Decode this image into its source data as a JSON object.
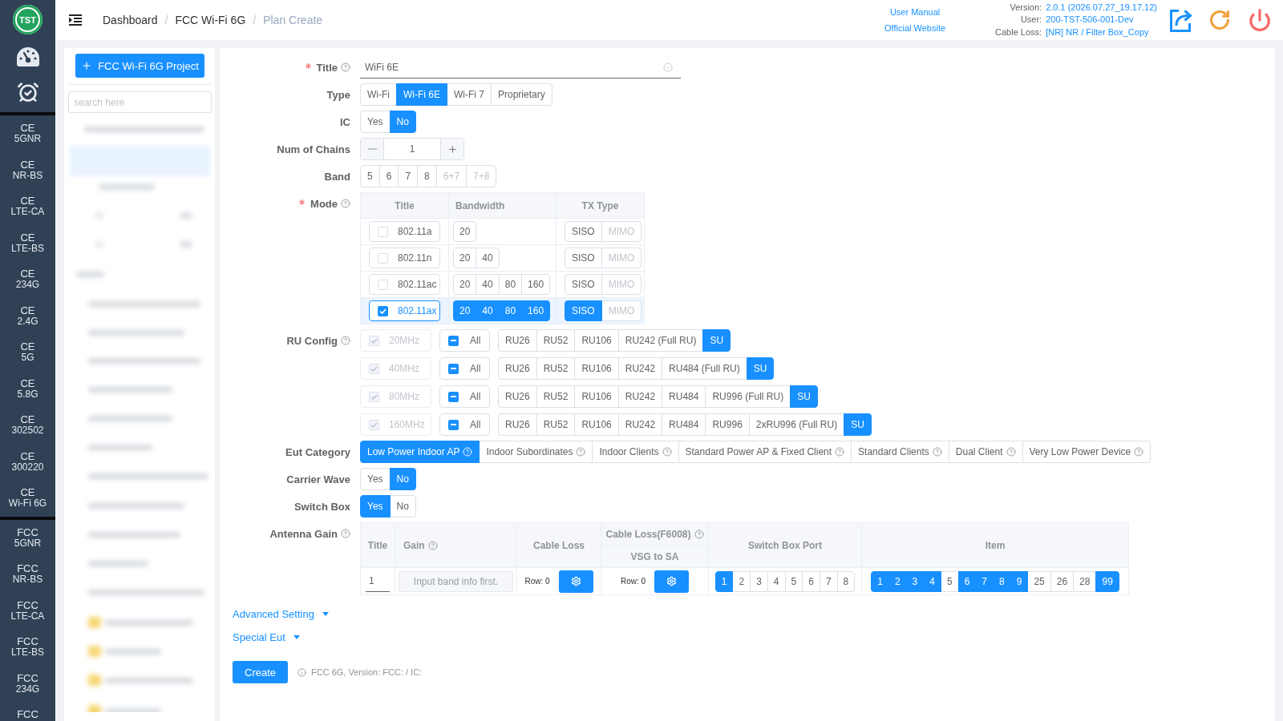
{
  "logo": {
    "text": "TST"
  },
  "nav_rail": {
    "groups": [
      {
        "items": [
          {
            "title": "CE",
            "subtitle": "5GNR",
            "selected": false
          },
          {
            "title": "CE",
            "subtitle": "NR-BS",
            "selected": false
          },
          {
            "title": "CE",
            "subtitle": "LTE-CA",
            "selected": false
          },
          {
            "title": "CE",
            "subtitle": "LTE-BS",
            "selected": false
          },
          {
            "title": "CE",
            "subtitle": "234G",
            "selected": false
          },
          {
            "title": "CE",
            "subtitle": "2.4G",
            "selected": false
          },
          {
            "title": "CE",
            "subtitle": "5G",
            "selected": false
          },
          {
            "title": "CE",
            "subtitle": "5.8G",
            "selected": false
          },
          {
            "title": "CE",
            "subtitle": "302502",
            "selected": false
          },
          {
            "title": "CE",
            "subtitle": "300220",
            "selected": false
          },
          {
            "title": "CE",
            "subtitle": "Wi-Fi 6G",
            "selected": false
          }
        ]
      },
      {
        "items": [
          {
            "title": "FCC",
            "subtitle": "5GNR",
            "selected": false
          },
          {
            "title": "FCC",
            "subtitle": "NR-BS",
            "selected": false
          },
          {
            "title": "FCC",
            "subtitle": "LTE-CA",
            "selected": false
          },
          {
            "title": "FCC",
            "subtitle": "LTE-BS",
            "selected": false
          },
          {
            "title": "FCC",
            "subtitle": "234G",
            "selected": false
          },
          {
            "title": "FCC",
            "selected": false
          }
        ]
      }
    ]
  },
  "header": {
    "breadcrumb": {
      "separator": "/",
      "items": [
        {
          "label": "Dashboard",
          "current": false
        },
        {
          "label": "FCC Wi-Fi 6G",
          "current": false
        },
        {
          "label": "Plan Create",
          "current": true
        }
      ]
    },
    "links": [
      "User Manual",
      "Official Website"
    ],
    "info": [
      {
        "label": "Version:",
        "value": "2.0.1 (2026.07.27_19.17.12)"
      },
      {
        "label": "User:",
        "value": "200-TST-506-001-Dev"
      },
      {
        "label": "Cable Loss:",
        "value": "[NR] NR / Filter Box_Copy"
      }
    ]
  },
  "project_panel": {
    "new_button": "FCC Wi-Fi 6G Project",
    "search": {
      "placeholder": "search here"
    }
  },
  "form": {
    "fields": [
      {
        "kind": "text",
        "label": "Title",
        "required": true,
        "help": true,
        "value": "WiFi 6E",
        "valid": true
      },
      {
        "kind": "choice",
        "label": "Type",
        "required": false,
        "help": false,
        "options": [
          {
            "label": "Wi-Fi",
            "selected": false,
            "disabled": false
          },
          {
            "label": "Wi-Fi 6E",
            "selected": true,
            "disabled": false
          },
          {
            "label": "Wi-Fi 7",
            "selected": false,
            "disabled": false
          },
          {
            "label": "Proprietary",
            "selected": false,
            "disabled": false
          }
        ]
      },
      {
        "kind": "choice",
        "label": "IC",
        "required": false,
        "help": false,
        "options": [
          {
            "label": "Yes",
            "selected": false,
            "disabled": false
          },
          {
            "label": "No",
            "selected": true,
            "disabled": false
          }
        ]
      },
      {
        "kind": "stepper",
        "label": "Num of Chains",
        "required": false,
        "help": false,
        "value": "1",
        "decrease_disabled": true
      },
      {
        "kind": "choice",
        "label": "Band",
        "required": false,
        "help": false,
        "options": [
          {
            "label": "5",
            "selected": false,
            "disabled": false
          },
          {
            "label": "6",
            "selected": false,
            "disabled": false
          },
          {
            "label": "7",
            "selected": false,
            "disabled": false
          },
          {
            "label": "8",
            "selected": false,
            "disabled": false
          },
          {
            "label": "6+7",
            "selected": false,
            "disabled": true
          },
          {
            "label": "7+8",
            "selected": false,
            "disabled": true
          }
        ]
      },
      {
        "kind": "mode_table",
        "label": "Mode",
        "required": true,
        "help": true,
        "columns": [
          "Title",
          "Bandwidth",
          "TX Type"
        ],
        "rows": [
          {
            "title": "802.11a",
            "checked": false,
            "bandwidths": [
              {
                "label": "20",
                "selected": false
              }
            ],
            "tx_types": [
              {
                "label": "SISO",
                "selected": false,
                "disabled": false
              },
              {
                "label": "MIMO",
                "selected": false,
                "disabled": true
              }
            ]
          },
          {
            "title": "802.11n",
            "checked": false,
            "bandwidths": [
              {
                "label": "20",
                "selected": false
              },
              {
                "label": "40",
                "selected": false
              }
            ],
            "tx_types": [
              {
                "label": "SISO",
                "selected": false,
                "disabled": false
              },
              {
                "label": "MIMO",
                "selected": false,
                "disabled": true
              }
            ]
          },
          {
            "title": "802.11ac",
            "checked": false,
            "bandwidths": [
              {
                "label": "20",
                "selected": false
              },
              {
                "label": "40",
                "selected": false
              },
              {
                "label": "80",
                "selected": false
              },
              {
                "label": "160",
                "selected": false
              }
            ],
            "tx_types": [
              {
                "label": "SISO",
                "selected": false,
                "disabled": false
              },
              {
                "label": "MIMO",
                "selected": false,
                "disabled": true
              }
            ]
          },
          {
            "title": "802.11ax",
            "checked": true,
            "bandwidths": [
              {
                "label": "20",
                "selected": true
              },
              {
                "label": "40",
                "selected": true
              },
              {
                "label": "80",
                "selected": true
              },
              {
                "label": "160",
                "selected": true
              }
            ],
            "tx_types": [
              {
                "label": "SISO",
                "selected": true,
                "disabled": false
              },
              {
                "label": "MIMO",
                "selected": false,
                "disabled": true
              }
            ]
          }
        ]
      },
      {
        "kind": "ru_config",
        "label": "RU Config",
        "required": false,
        "help": true,
        "rows": [
          {
            "bandwidth": {
              "label": "20MHz",
              "checked": true,
              "disabled": true
            },
            "all": {
              "label": "All",
              "indeterminate": true
            },
            "units": [
              {
                "label": "RU26",
                "selected": false
              },
              {
                "label": "RU52",
                "selected": false
              },
              {
                "label": "RU106",
                "selected": false
              },
              {
                "label": "RU242 (Full RU)",
                "selected": false
              },
              {
                "label": "SU",
                "selected": true
              }
            ]
          },
          {
            "bandwidth": {
              "label": "40MHz",
              "checked": true,
              "disabled": true
            },
            "all": {
              "label": "All",
              "indeterminate": true
            },
            "units": [
              {
                "label": "RU26",
                "selected": false
              },
              {
                "label": "RU52",
                "selected": false
              },
              {
                "label": "RU106",
                "selected": false
              },
              {
                "label": "RU242",
                "selected": false
              },
              {
                "label": "RU484 (Full RU)",
                "selected": false
              },
              {
                "label": "SU",
                "selected": true
              }
            ]
          },
          {
            "bandwidth": {
              "label": "80MHz",
              "checked": true,
              "disabled": true
            },
            "all": {
              "label": "All",
              "indeterminate": true
            },
            "units": [
              {
                "label": "RU26",
                "selected": false
              },
              {
                "label": "RU52",
                "selected": false
              },
              {
                "label": "RU106",
                "selected": false
              },
              {
                "label": "RU242",
                "selected": false
              },
              {
                "label": "RU484",
                "selected": false
              },
              {
                "label": "RU996 (Full RU)",
                "selected": false
              },
              {
                "label": "SU",
                "selected": true
              }
            ]
          },
          {
            "bandwidth": {
              "label": "160MHz",
              "checked": true,
              "disabled": true
            },
            "all": {
              "label": "All",
              "indeterminate": true
            },
            "units": [
              {
                "label": "RU26",
                "selected": false
              },
              {
                "label": "RU52",
                "selected": false
              },
              {
                "label": "RU106",
                "selected": false
              },
              {
                "label": "RU242",
                "selected": false
              },
              {
                "label": "RU484",
                "selected": false
              },
              {
                "label": "RU996",
                "selected": false
              },
              {
                "label": "2xRU996 (Full RU)",
                "selected": false
              },
              {
                "label": "SU",
                "selected": true
              }
            ]
          }
        ]
      },
      {
        "kind": "choice",
        "label": "Eut Category",
        "required": false,
        "help": false,
        "options": [
          {
            "label": "Low Power Indoor AP",
            "selected": true,
            "disabled": false,
            "help": true
          },
          {
            "label": "Indoor Subordinates",
            "selected": false,
            "disabled": false,
            "help": true
          },
          {
            "label": "Indoor Clients",
            "selected": false,
            "disabled": false,
            "help": true
          },
          {
            "label": "Standard Power AP & Fixed Client",
            "selected": false,
            "disabled": false,
            "help": true
          },
          {
            "label": "Standard Clients",
            "selected": false,
            "disabled": false,
            "help": true
          },
          {
            "label": "Dual Client",
            "selected": false,
            "disabled": false,
            "help": true
          },
          {
            "label": "Very Low Power Device",
            "selected": false,
            "disabled": false,
            "help": true
          }
        ]
      },
      {
        "kind": "choice",
        "label": "Carrier Wave",
        "required": false,
        "help": false,
        "options": [
          {
            "label": "Yes",
            "selected": false,
            "disabled": false
          },
          {
            "label": "No",
            "selected": true,
            "disabled": false
          }
        ]
      },
      {
        "kind": "choice",
        "label": "Switch Box",
        "required": false,
        "help": false,
        "options": [
          {
            "label": "Yes",
            "selected": true,
            "disabled": false
          },
          {
            "label": "No",
            "selected": false,
            "disabled": false
          }
        ]
      },
      {
        "kind": "antenna_table",
        "label": "Antenna Gain",
        "required": false,
        "help": true,
        "columns": [
          {
            "label": "Title",
            "help": false
          },
          {
            "label": "Gain",
            "help": true
          },
          {
            "label": "Cable Loss",
            "help": false
          },
          {
            "label": "Cable Loss(F6008)",
            "help": true,
            "sublabel": "VSG to SA"
          },
          {
            "label": "Switch Box Port",
            "help": false
          },
          {
            "label": "Item",
            "help": false
          }
        ],
        "row": {
          "title": "1",
          "gain": {
            "placeholder": "Input band info first.",
            "disabled": true
          },
          "cable_loss": "Row: 0",
          "cable_loss_f6008": "Row: 0",
          "ports": [
            {
              "label": "1",
              "selected": true
            },
            {
              "label": "2",
              "selected": false
            },
            {
              "label": "3",
              "selected": false
            },
            {
              "label": "4",
              "selected": false
            },
            {
              "label": "5",
              "selected": false
            },
            {
              "label": "6",
              "selected": false
            },
            {
              "label": "7",
              "selected": false
            },
            {
              "label": "8",
              "selected": false
            }
          ],
          "items": [
            {
              "label": "1",
              "selected": true
            },
            {
              "label": "2",
              "selected": true
            },
            {
              "label": "3",
              "selected": true
            },
            {
              "label": "4",
              "selected": true
            },
            {
              "label": "5",
              "selected": false
            },
            {
              "label": "6",
              "selected": true
            },
            {
              "label": "7",
              "selected": true
            },
            {
              "label": "8",
              "selected": true
            },
            {
              "label": "9",
              "selected": true
            },
            {
              "label": "25",
              "selected": false
            },
            {
              "label": "26",
              "selected": false
            },
            {
              "label": "28",
              "selected": false
            },
            {
              "label": "99",
              "selected": true
            }
          ]
        }
      }
    ],
    "sections": [
      {
        "label": "Advanced Setting"
      },
      {
        "label": "Special Eut"
      }
    ],
    "submit": "Create",
    "note": "FCC 6G, Version: FCC: / IC:"
  }
}
